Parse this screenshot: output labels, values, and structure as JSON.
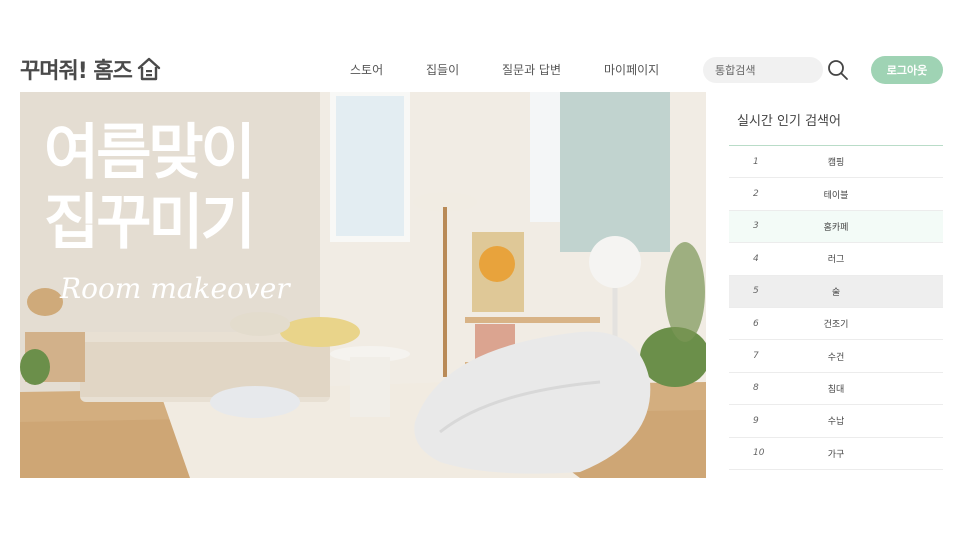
{
  "brand": {
    "logo_text": "꾸며줘! 홈즈",
    "accent_color": "#9fd3b4"
  },
  "nav": {
    "items": [
      {
        "label": "스토어"
      },
      {
        "label": "집들이"
      },
      {
        "label": "질문과 답변"
      },
      {
        "label": "마이페이지"
      }
    ]
  },
  "search": {
    "placeholder": "통합검색",
    "icon": "search-icon"
  },
  "auth": {
    "logout_label": "로그아웃"
  },
  "hero": {
    "title_line1": "여름맞이",
    "title_line2": "집꾸미기",
    "subtitle": "Room makeover"
  },
  "ranking": {
    "title": "실시간 인기 검색어",
    "items": [
      {
        "rank": "1",
        "keyword": "캠핑"
      },
      {
        "rank": "2",
        "keyword": "테이블"
      },
      {
        "rank": "3",
        "keyword": "홈카페"
      },
      {
        "rank": "4",
        "keyword": "러그"
      },
      {
        "rank": "5",
        "keyword": "술"
      },
      {
        "rank": "6",
        "keyword": "건조기"
      },
      {
        "rank": "7",
        "keyword": "수건"
      },
      {
        "rank": "8",
        "keyword": "침대"
      },
      {
        "rank": "9",
        "keyword": "수납"
      },
      {
        "rank": "10",
        "keyword": "가구"
      }
    ]
  }
}
